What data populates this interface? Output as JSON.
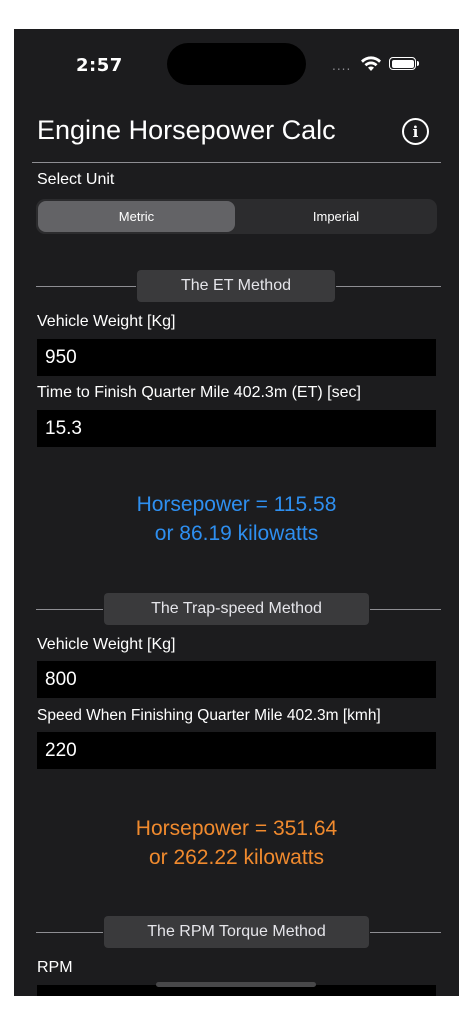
{
  "status_bar": {
    "time": "2:57",
    "signal": "....",
    "wifi_icon": "wifi-icon",
    "battery_icon": "battery-icon"
  },
  "header": {
    "title": "Engine Horsepower Calc",
    "info_icon": "info-icon"
  },
  "unit_selector": {
    "label": "Select Unit",
    "options": [
      "Metric",
      "Imperial"
    ],
    "selected": "Metric"
  },
  "et_method": {
    "title": "The ET Method",
    "weight_label": "Vehicle Weight [Kg]",
    "weight_value": "950",
    "time_label": "Time to Finish Quarter Mile 402.3m (ET) [sec]",
    "time_value": "15.3",
    "result_hp": "Horsepower = 115.58",
    "result_kw": "or 86.19 kilowatts",
    "result_color": "#2e8ff0"
  },
  "trap_method": {
    "title": "The Trap-speed Method",
    "weight_label": "Vehicle Weight [Kg]",
    "weight_value": "800",
    "speed_label": "Speed When Finishing Quarter Mile 402.3m [kmh]",
    "speed_value": "220",
    "result_hp": "Horsepower = 351.64",
    "result_kw": "or 262.22 kilowatts",
    "result_color": "#f08a2e"
  },
  "rpm_method": {
    "title": "The RPM Torque Method",
    "rpm_label": "RPM"
  }
}
